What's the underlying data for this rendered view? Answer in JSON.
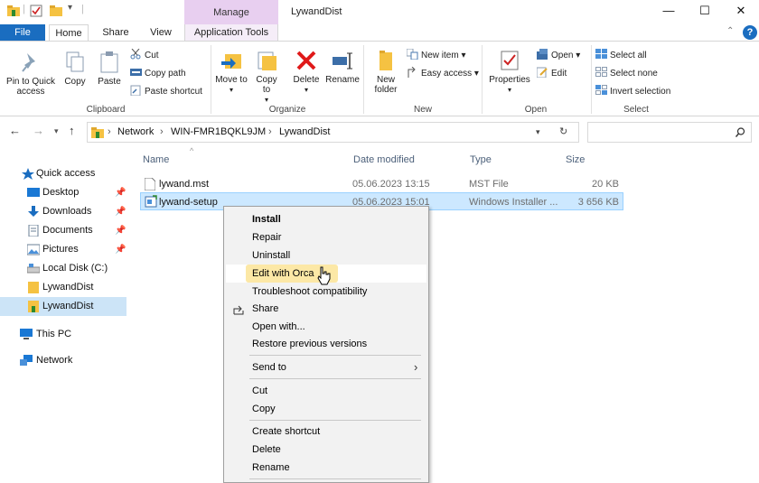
{
  "window": {
    "title": "LywandDist",
    "context_tab": "Manage",
    "controls": {
      "minimize": "—",
      "maximize": "☐",
      "close": "✕"
    }
  },
  "ribbon_tabs": [
    "File",
    "Home",
    "Share",
    "View",
    "Application Tools"
  ],
  "ribbon": {
    "pin_to_quick_access": "Pin to Quick access",
    "copy": "Copy",
    "paste": "Paste",
    "cut": "Cut",
    "copy_path": "Copy path",
    "paste_shortcut": "Paste shortcut",
    "clipboard_group": "Clipboard",
    "move_to": "Move to",
    "copy_to": "Copy to",
    "delete": "Delete",
    "rename": "Rename",
    "organize_group": "Organize",
    "new_folder": "New folder",
    "new_item": "New item",
    "easy_access": "Easy access",
    "new_group": "New",
    "properties": "Properties",
    "open": "Open",
    "edit": "Edit",
    "open_group": "Open",
    "select_all": "Select all",
    "select_none": "Select none",
    "invert_selection": "Invert selection",
    "select_group": "Select"
  },
  "address": {
    "crumbs": [
      "Network",
      "WIN-FMR1BQKL9JM",
      "LywandDist"
    ],
    "search_placeholder": ""
  },
  "nav": {
    "quick_access": "Quick access",
    "items": [
      "Desktop",
      "Downloads",
      "Documents",
      "Pictures",
      "Local Disk (C:)",
      "LywandDist",
      "LywandDist"
    ],
    "this_pc": "This PC",
    "network": "Network"
  },
  "columns": {
    "name": "Name",
    "date": "Date modified",
    "type": "Type",
    "size": "Size"
  },
  "files": [
    {
      "name": "lywand.mst",
      "date": "05.06.2023 13:15",
      "type": "MST File",
      "size": "20 KB"
    },
    {
      "name": "lywand-setup",
      "date": "05.06.2023 15:01",
      "type": "Windows Installer ...",
      "size": "3 656 KB"
    }
  ],
  "context_menu": {
    "install": "Install",
    "repair": "Repair",
    "uninstall": "Uninstall",
    "edit_with_orca": "Edit with Orca",
    "troubleshoot": "Troubleshoot compatibility",
    "share": "Share",
    "open_with": "Open with...",
    "restore": "Restore previous versions",
    "send_to": "Send to",
    "cut": "Cut",
    "copy": "Copy",
    "create_shortcut": "Create shortcut",
    "delete": "Delete",
    "rename": "Rename"
  }
}
